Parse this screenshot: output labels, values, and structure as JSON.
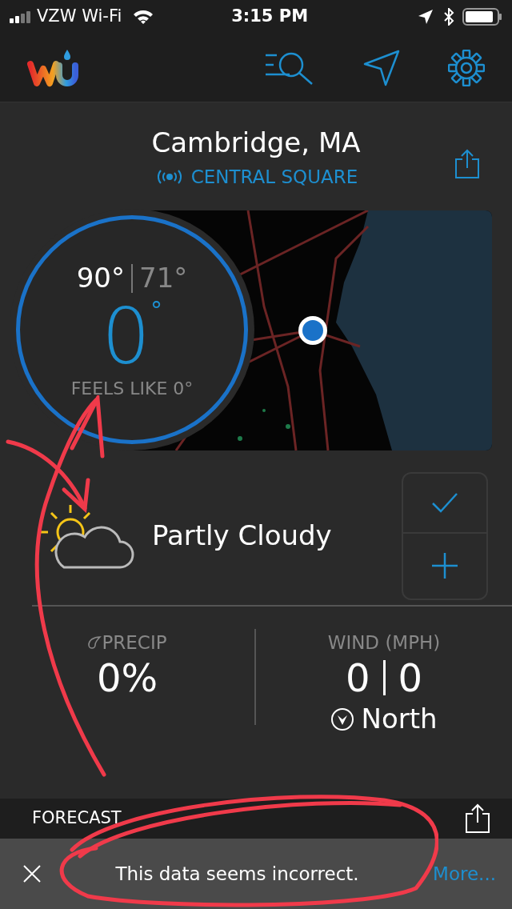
{
  "status_bar": {
    "carrier": "VZW Wi-Fi",
    "time": "3:15 PM"
  },
  "header": {
    "location": "Cambridge, MA",
    "station": "CENTRAL SQUARE"
  },
  "current": {
    "high": "90°",
    "low": "71°",
    "temperature": "0",
    "unit": "°",
    "feels_like": "FEELS LIKE 0°"
  },
  "condition": "Partly Cloudy",
  "precip": {
    "label": "PRECIP",
    "value": "0%"
  },
  "wind": {
    "label": "WIND (MPH)",
    "speed": "0",
    "gust": "0",
    "direction": "North"
  },
  "forecast": {
    "label": "FORECAST"
  },
  "toast": {
    "message": "This data seems incorrect.",
    "link": "More..."
  }
}
